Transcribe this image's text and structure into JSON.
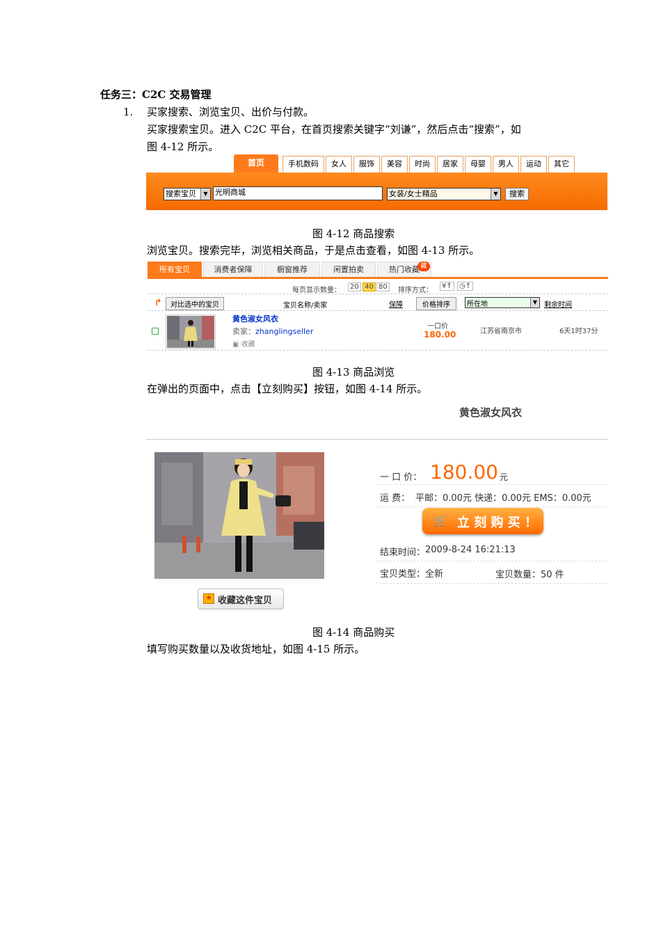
{
  "heading": "任务三：C2C 交易管理",
  "item1": {
    "number": "1.",
    "text": "买家搜索、浏览宝贝、出价与付款。",
    "para_line1": "买家搜索宝贝。进入 C2C 平台，在首页搜索关键字“刘谦”，然后点击“搜索”，如",
    "para_line2": "图 4-12 所示。"
  },
  "fig12": {
    "tabs": [
      "首页",
      "手机数码",
      "女人",
      "服饰",
      "美容",
      "时尚",
      "居家",
      "母婴",
      "男人",
      "运动",
      "其它"
    ],
    "search_type": "搜索宝贝",
    "keyword": "光明商城",
    "category": "女装/女士精品",
    "search_button": "搜索",
    "caption": "图 4-12 商品搜索"
  },
  "para2": "浏览宝贝。搜索完毕，浏览相关商品，于是点击查看，如图 4-13 所示。",
  "fig13": {
    "tabs": [
      "所有宝贝",
      "消费者保障",
      "橱窗推荐",
      "闲置拍卖",
      "热门收藏"
    ],
    "hot_badge": "藏",
    "per_page_label": "每页显示数量：",
    "per_page_options": [
      "20",
      "40",
      "80"
    ],
    "sort_label": "排序方式：",
    "sort_icons": [
      "¥↑",
      "◷↑"
    ],
    "compare_button": "对比选中的宝贝",
    "col_name": "宝贝名称/卖家",
    "col_guarantee": "保障",
    "col_price_sort": "价格排序",
    "col_location": "所在地",
    "col_time": "剩余时间",
    "item": {
      "title": "黄色淑女风衣",
      "seller_label": "卖家：",
      "seller": "zhanglingseller",
      "fav": "收藏",
      "price_label": "一口价",
      "price": "180.00",
      "location": "江苏省南京市",
      "time_left": "6天1时37分"
    },
    "caption": "图 4-13 商品浏览"
  },
  "para3": "在弹出的页面中，点击【立刻购买】按钮，如图 4-14 所示。",
  "fig14": {
    "title": "黄色淑女风衣",
    "price_label": "一 口 价：",
    "price": "180.00",
    "price_unit": "元",
    "shipping_label": "运  费：",
    "shipping": "平邮：0.00元  快递：0.00元  EMS：0.00元",
    "buy_button": "立 刻 购 买 ！",
    "end_time_label": "结束时间：",
    "end_time": "2009-8-24 16:21:13",
    "type_label": "宝贝类型：",
    "type": "全新",
    "qty_label": "宝贝数量：",
    "qty": "50 件",
    "fav_button": "收藏这件宝贝",
    "caption": "图 4-14 商品购买"
  },
  "para4": "填写购买数量以及收货地址，如图 4-15 所示。",
  "colors": {
    "accent": "#ff7a1a",
    "price": "#ff6600",
    "link": "#0033cc"
  }
}
